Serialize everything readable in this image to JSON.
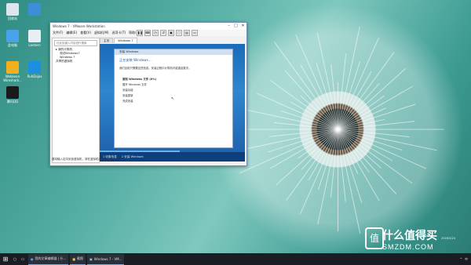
{
  "desktop": {
    "icons": [
      {
        "label": "回收站",
        "icon": "recycle-bin-icon",
        "color": "#dde6ef"
      },
      {
        "label": "",
        "icon": "feather-app-icon",
        "color": "#3a8fd8"
      },
      {
        "label": "此电脑",
        "icon": "computer-icon",
        "color": "#4aa2e8"
      },
      {
        "label": "Lantern",
        "icon": "lantern-icon",
        "color": "#e9eef4"
      },
      {
        "label": "Webkeon Wireshark...",
        "icon": "webkeon-icon",
        "color": "#f2b01e"
      },
      {
        "label": "RuhDojos",
        "icon": "app-icon",
        "color": "#1d8fe0"
      },
      {
        "label": "腾讯QQ",
        "icon": "qq-icon",
        "color": "#1a1a1a"
      }
    ]
  },
  "vmware": {
    "title": "Windows 7 - VMware Workstation",
    "menu": [
      "文件(F)",
      "编辑(E)",
      "查看(V)",
      "虚拟机(M)",
      "选项卡(T)",
      "帮助(H)"
    ],
    "search_placeholder": "在此处键入内容进行搜索",
    "tree": [
      "我的计算机",
      "测试Windows7",
      "Windows 7",
      "共享的虚拟机"
    ],
    "tabs": [
      "主页",
      "Windows 7"
    ],
    "status": "要将输入定向到该虚拟机，请在虚拟机内部单击或按 Ctrl+G。",
    "guest": {
      "dialog_head": "安装 Windows",
      "heading": "正在安装 Windows...",
      "intro": "我们目前只需要这些信息。安装过程中计算机可能重启数次。",
      "steps": [
        "复制 Windows 文件 (0%)",
        "展开 Windows 文件",
        "安装功能",
        "安装更新",
        "完成安装"
      ],
      "bar_items": [
        "1  收集信息",
        "2  安装 Windows"
      ],
      "progress": 0.55
    }
  },
  "taskbar": {
    "items": [
      "我的文章编辑器 | 什...",
      "截图",
      "Windows 7 - VM..."
    ],
    "tray": [
      "^",
      "中"
    ]
  },
  "watermark": {
    "big": "什么值得买",
    "small": "SMZDM.COM",
    "logo": "值"
  },
  "timestamp": "2016/3/24"
}
